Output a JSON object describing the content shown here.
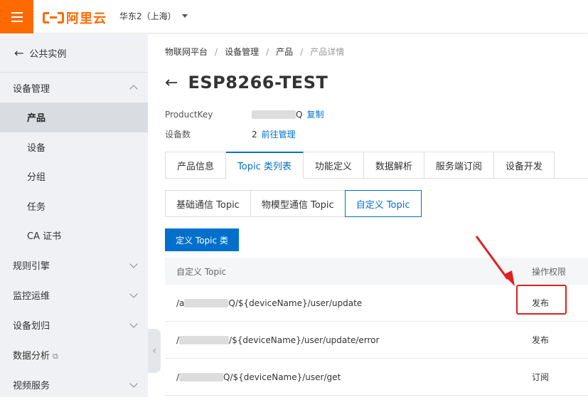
{
  "topbar": {
    "logo_text": "阿里云",
    "region": "华东2（上海）"
  },
  "sidebar": {
    "back_label": "公共实例",
    "groups": [
      {
        "label": "设备管理",
        "expanded": true
      },
      {
        "label": "规则引擎"
      },
      {
        "label": "监控运维"
      },
      {
        "label": "设备划归"
      },
      {
        "label": "数据分析"
      },
      {
        "label": "视频服务"
      }
    ],
    "items": [
      {
        "label": "产品",
        "active": true
      },
      {
        "label": "设备"
      },
      {
        "label": "分组"
      },
      {
        "label": "任务"
      },
      {
        "label": "CA 证书"
      }
    ]
  },
  "breadcrumb": [
    "物联网平台",
    "产品",
    "设备管理",
    "产品详情"
  ],
  "page": {
    "title": "ESP8266-TEST",
    "product_key_label": "ProductKey",
    "product_key_value_suffix": "Q",
    "copy_link": "复制",
    "device_count_label": "设备数",
    "device_count": "2",
    "manage_link": "前往管理"
  },
  "tabs": [
    "产品信息",
    "Topic 类列表",
    "功能定义",
    "数据解析",
    "服务端订阅",
    "设备开发"
  ],
  "active_tab": 1,
  "subtabs": [
    "基础通信 Topic",
    "物模型通信 Topic",
    "自定义 Topic"
  ],
  "active_subtab": 2,
  "define_button": "定义 Topic 类",
  "table": {
    "headers": [
      "自定义 Topic",
      "操作权限"
    ],
    "rows": [
      {
        "topic_prefix": "/a",
        "topic_suffix": "Q/${deviceName}/user/update",
        "permission": "发布"
      },
      {
        "topic_prefix": "/",
        "topic_suffix": "/${deviceName}/user/update/error",
        "permission": "发布"
      },
      {
        "topic_prefix": "/",
        "topic_suffix": "Q/${deviceName}/user/get",
        "permission": "订阅"
      }
    ]
  },
  "colors": {
    "brand": "#ff6a00",
    "link": "#0070cc",
    "annotation": "#e02020"
  }
}
